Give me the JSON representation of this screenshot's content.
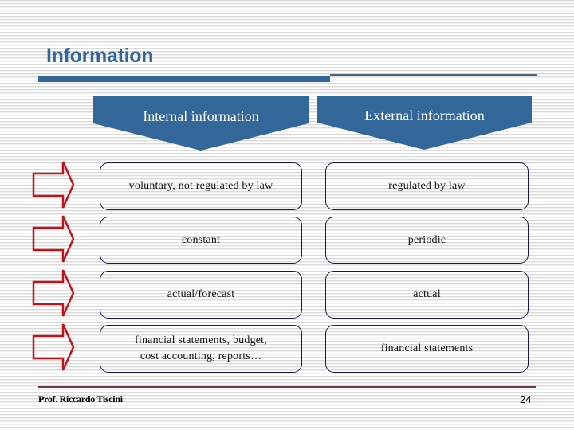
{
  "slide": {
    "title": "Information",
    "columns": [
      {
        "header": "Internal information",
        "color": "#336699"
      },
      {
        "header": "External information",
        "color": "#336699"
      }
    ],
    "rows": [
      {
        "internal": "voluntary, not regulated by law",
        "external": "regulated by law"
      },
      {
        "internal": "constant",
        "external": "periodic"
      },
      {
        "internal": "actual/forecast",
        "external": "actual"
      },
      {
        "internal": "financial statements, budget,\ncost accounting, reports…",
        "external": "financial statements"
      }
    ],
    "arrow_icon": "right-arrow-outline-icon",
    "arrow_color": "#c0141c",
    "footer": {
      "author": "Prof. Riccardo Tiscini",
      "page_number": "24"
    }
  }
}
